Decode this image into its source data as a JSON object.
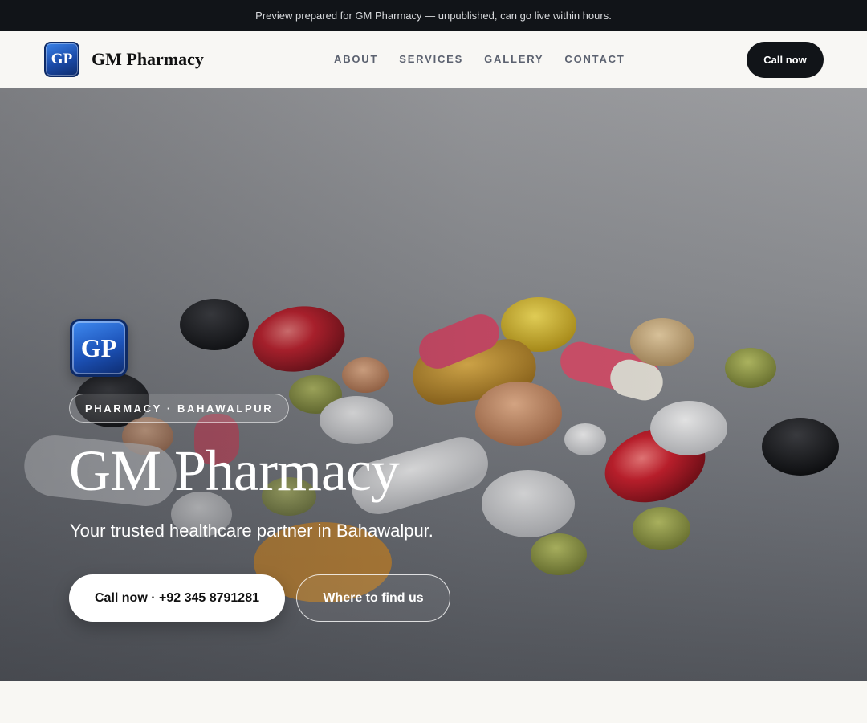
{
  "preview_banner": "Preview prepared for GM Pharmacy — unpublished, can go live within hours.",
  "header": {
    "logo_text": "GP",
    "brand_name": "GM Pharmacy",
    "nav": [
      "ABOUT",
      "SERVICES",
      "GALLERY",
      "CONTACT"
    ],
    "cta": "Call now"
  },
  "hero": {
    "logo_text": "GP",
    "eyebrow": "PHARMACY · BAHAWALPUR",
    "title": "GM Pharmacy",
    "subtitle": "Your trusted healthcare partner in Bahawalpur.",
    "primary_button": "Call now · +92 345 8791281",
    "secondary_button": "Where to find us",
    "background_image": "assorted pills and capsules"
  },
  "colors": {
    "dark": "#111418",
    "nav_link": "#5c6270",
    "logo_blue": "#1c52b8",
    "page_bg": "#f8f7f3"
  }
}
